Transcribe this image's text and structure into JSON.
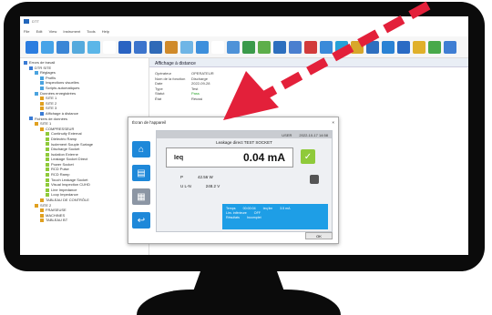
{
  "window": {
    "title": "DTT"
  },
  "menu": [
    "File",
    "Edit",
    "View",
    "Instrument",
    "Tools",
    "Help"
  ],
  "tree": [
    {
      "label": "Errors de travail",
      "level": 0,
      "color": "#3a7bd5"
    },
    {
      "label": "DTR SITE",
      "level": 1,
      "color": "#3a7bd5"
    },
    {
      "label": "Réglages",
      "level": 2,
      "color": "#4aa3df"
    },
    {
      "label": "Profils",
      "level": 3,
      "color": "#4aa3df"
    },
    {
      "label": "Inspections visuelles",
      "level": 3,
      "color": "#4aa3df"
    },
    {
      "label": "Scripts automatiques",
      "level": 3,
      "color": "#4aa3df"
    },
    {
      "label": "Données enregistrées",
      "level": 2,
      "color": "#4aa3df"
    },
    {
      "label": "SITE 1",
      "level": 3,
      "color": "#e0a020"
    },
    {
      "label": "SITE 2",
      "level": 3,
      "color": "#e0a020"
    },
    {
      "label": "SITE 3",
      "level": 3,
      "color": "#e0a020"
    },
    {
      "label": "Affichage à distance",
      "level": 3,
      "color": "#3a7bd5"
    },
    {
      "label": "Fichiers de données",
      "level": 1,
      "color": "#3a7bd5"
    },
    {
      "label": "SITE 1",
      "level": 2,
      "color": "#e0a020"
    },
    {
      "label": "COMPRESSEUR",
      "level": 3,
      "color": "#e0a020"
    },
    {
      "label": "Continuity External",
      "level": 4,
      "color": "#8fca3a"
    },
    {
      "label": "Dielectric Ramp",
      "level": 4,
      "color": "#8fca3a"
    },
    {
      "label": "Isolement Souple Surtage",
      "level": 4,
      "color": "#8fca3a"
    },
    {
      "label": "Discharge Socket",
      "level": 4,
      "color": "#8fca3a"
    },
    {
      "label": "Isolation Externe",
      "level": 4,
      "color": "#8fca3a"
    },
    {
      "label": "Leakage Socket Direct",
      "level": 4,
      "color": "#8fca3a"
    },
    {
      "label": "Power Socket",
      "level": 4,
      "color": "#8fca3a"
    },
    {
      "label": "RCD Pulse",
      "level": 4,
      "color": "#8fca3a"
    },
    {
      "label": "RCD Ramp",
      "level": 4,
      "color": "#8fca3a"
    },
    {
      "label": "Touch Leakage Socket",
      "level": 4,
      "color": "#8fca3a"
    },
    {
      "label": "Visual Inspection CUHD",
      "level": 4,
      "color": "#8fca3a"
    },
    {
      "label": "Line Impedance",
      "level": 4,
      "color": "#8fca3a"
    },
    {
      "label": "Loop Impedance",
      "level": 4,
      "color": "#8fca3a"
    },
    {
      "label": "TABLEAU DE CONTRÔLE",
      "level": 3,
      "color": "#e0a020"
    },
    {
      "label": "SITE 2",
      "level": 2,
      "color": "#e0a020"
    },
    {
      "label": "FRAISEUSE",
      "level": 3,
      "color": "#e0a020"
    },
    {
      "label": "MACHINES",
      "level": 3,
      "color": "#e0a020"
    },
    {
      "label": "TABLEAU BT",
      "level": 3,
      "color": "#e0a020"
    }
  ],
  "main": {
    "header": "Affichage à distance",
    "props": [
      {
        "k": "Opérateur",
        "v": "OPERATEUR"
      },
      {
        "k": "Nom de la fonction",
        "v": "Discharge"
      },
      {
        "k": "Date",
        "v": "2022-09-28"
      },
      {
        "k": "Type",
        "v": "Test"
      },
      {
        "k": "Statut",
        "v": "Pass"
      },
      {
        "k": "État",
        "v": "Réussi"
      }
    ],
    "bottom_label": "Temps écoulé",
    "bottom_value": "100 s"
  },
  "dialog": {
    "title": "Écran de l'appareil",
    "close": "×",
    "status": {
      "user": "USER",
      "datetime": "2022-10-17  14:58"
    },
    "measure_title": "Leakage direct TEST SOCKET",
    "measure_symbol": "Ieq",
    "measure_value": "0.04 mA",
    "p_label": "P",
    "p_value": "42.56 W",
    "u_label": "U L-N",
    "u_value": "248.2 V",
    "info": [
      {
        "k": "Temps",
        "v": "00:00:04",
        "k2": "Ieq lim",
        "v2": "3.5 mA"
      },
      {
        "k": "Lim. inférieure",
        "v": "OFF"
      },
      {
        "k": "Résultats",
        "v": "Incomplet"
      }
    ],
    "ok": "OK"
  }
}
